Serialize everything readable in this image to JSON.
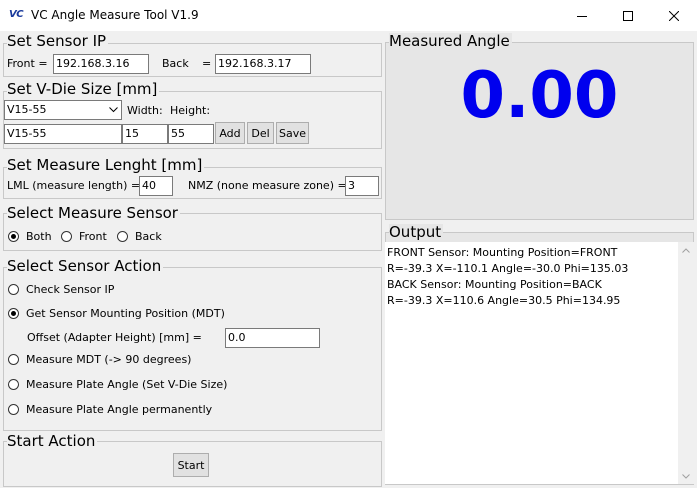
{
  "window": {
    "icon_text": "VC",
    "title": "VC Angle Measure Tool V1.9"
  },
  "sensor_ip": {
    "title": "Set Sensor IP",
    "front_label": "Front  =",
    "front_value": "192.168.3.16",
    "back_label": "Back",
    "back_eq": "=",
    "back_value": "192.168.3.17"
  },
  "vdie": {
    "title": "Set V-Die Size [mm]",
    "selected": "V15-55",
    "width_label": "Width:",
    "height_label": "Height:",
    "name_value": "V15-55",
    "width_value": "15",
    "height_value": "55",
    "add_label": "Add",
    "del_label": "Del",
    "save_label": "Save"
  },
  "measure_length": {
    "title": "Set Measure Lenght [mm]",
    "lml_label": "LML (measure length) =",
    "lml_value": "40",
    "nmz_label": "NMZ (none measure zone) =",
    "nmz_value": "3"
  },
  "measure_sensor": {
    "title": "Select Measure Sensor",
    "options": [
      "Both",
      "Front",
      "Back"
    ],
    "selected": 0
  },
  "sensor_action": {
    "title": "Select Sensor Action",
    "options": [
      "Check Sensor IP",
      "Get Sensor Mounting Position (MDT)",
      "Measure MDT (-> 90 degrees)",
      "Measure Plate Angle (Set V-Die Size)",
      "Measure Plate Angle permanently"
    ],
    "selected": 1,
    "offset_label": "Offset (Adapter Height) [mm]  =",
    "offset_value": "0.0"
  },
  "start": {
    "title": "Start Action",
    "button_label": "Start"
  },
  "measured": {
    "title": "Measured Angle",
    "value": "0.00",
    "value_color": "#0000ee"
  },
  "output": {
    "title": "Output",
    "lines": [
      "FRONT Sensor: Mounting Position=FRONT",
      "R=-39.3 X=-110.1 Angle=-30.0 Phi=135.03",
      "BACK  Sensor: Mounting Position=BACK",
      "R=-39.3 X=110.6 Angle=30.5 Phi=134.95"
    ]
  }
}
